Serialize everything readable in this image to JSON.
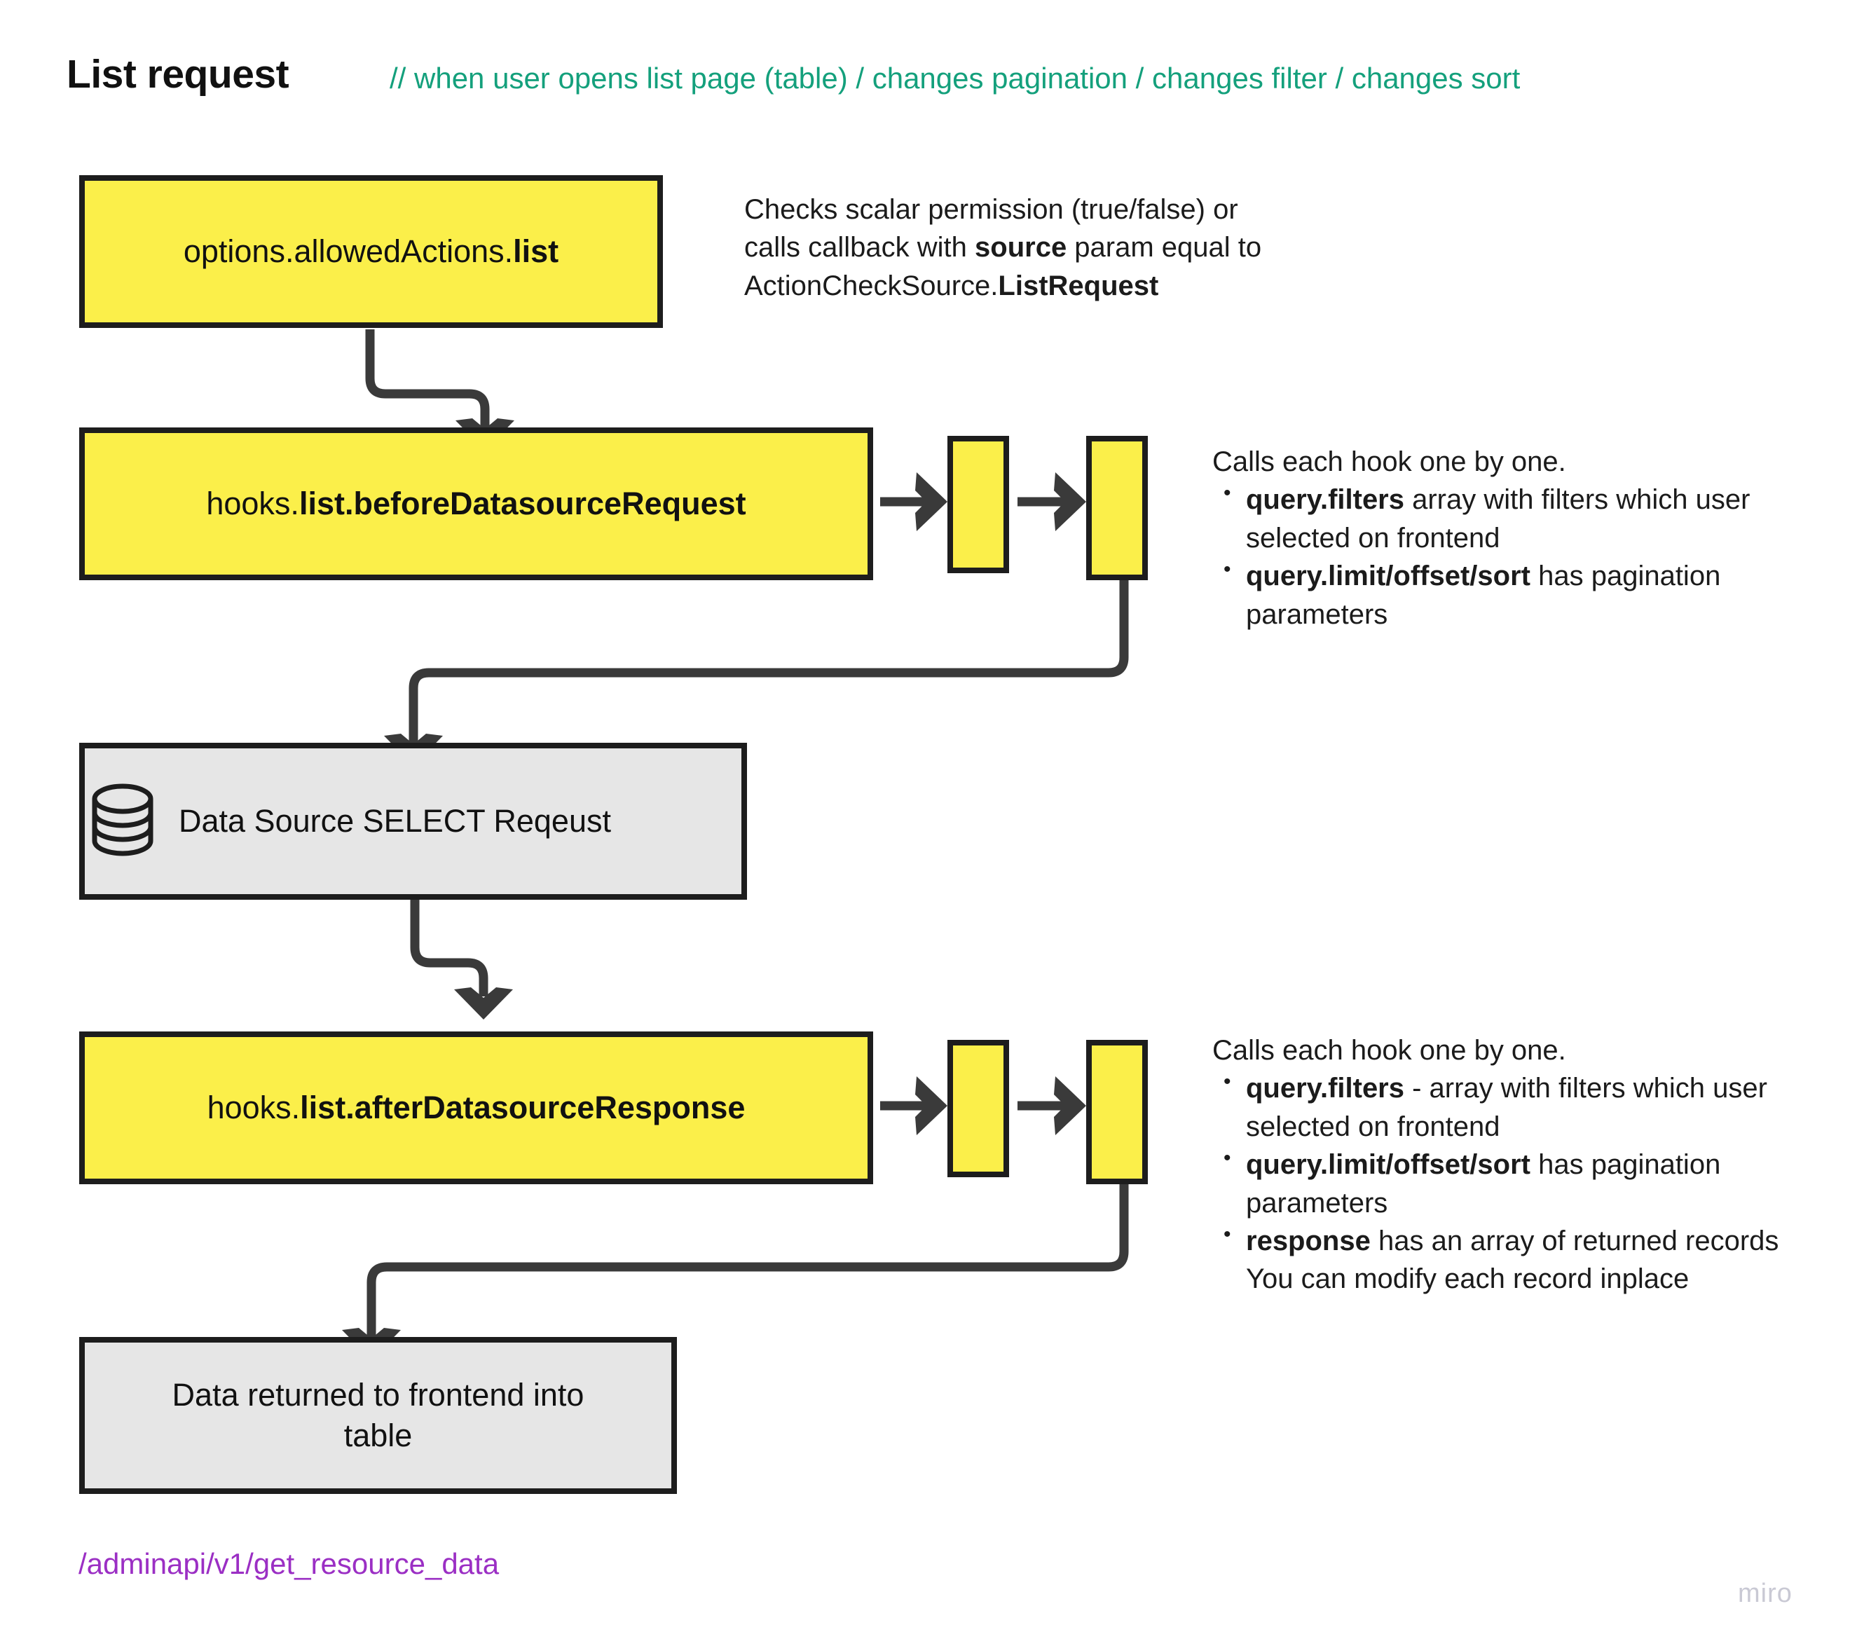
{
  "header": {
    "title": "List request",
    "subtitle": "// when user opens list page (table) / changes pagination / changes filter / changes sort"
  },
  "colors": {
    "node_yellow": "#fbef4a",
    "node_grey": "#e6e6e6",
    "node_border": "#1d1d1d",
    "subtitle_green": "#14a07c",
    "endpoint_purple": "#9b2fc4",
    "connector": "#3a3a3a",
    "watermark": "#c9c9d4"
  },
  "nodes": {
    "allowed_actions": {
      "text_plain": "options.allowedActions.",
      "text_bold": "list"
    },
    "before_hook": {
      "text_plain": "hooks.",
      "text_bold": "list.beforeDatasourceRequest"
    },
    "datasource": {
      "label": "Data Source SELECT Reqeust",
      "icon": "database-icon"
    },
    "after_hook": {
      "text_plain": "hooks.",
      "text_bold": "list.afterDatasourceResponse"
    },
    "result": {
      "label": "Data returned to frontend into table"
    }
  },
  "annotations": {
    "permission": {
      "line1_a": "Checks scalar permission (true/false) or",
      "line2_a": "calls callback with ",
      "line2_b": "source",
      "line2_c": " param equal to",
      "line3_a": "ActionCheckSource.",
      "line3_b": "ListRequest"
    },
    "before_hook": {
      "lead": "Calls each hook one by one.",
      "bullets": [
        {
          "bold": "query.filters",
          "rest": " array with filters which user selected on frontend"
        },
        {
          "bold": "query.limit/offset/sort",
          "rest": " has pagination parameters"
        }
      ]
    },
    "after_hook": {
      "lead": "Calls each hook one by one.",
      "bullets": [
        {
          "bold": "query.filters",
          "rest": " - array with filters which user selected on frontend"
        },
        {
          "bold": "query.limit/offset/sort",
          "rest": " has pagination parameters"
        },
        {
          "bold": "response",
          "rest": " has an array of returned records"
        }
      ],
      "trailing": "You can modify each record inplace"
    }
  },
  "footer": {
    "endpoint": "/adminapi/v1/get_resource_data",
    "watermark": "miro"
  }
}
